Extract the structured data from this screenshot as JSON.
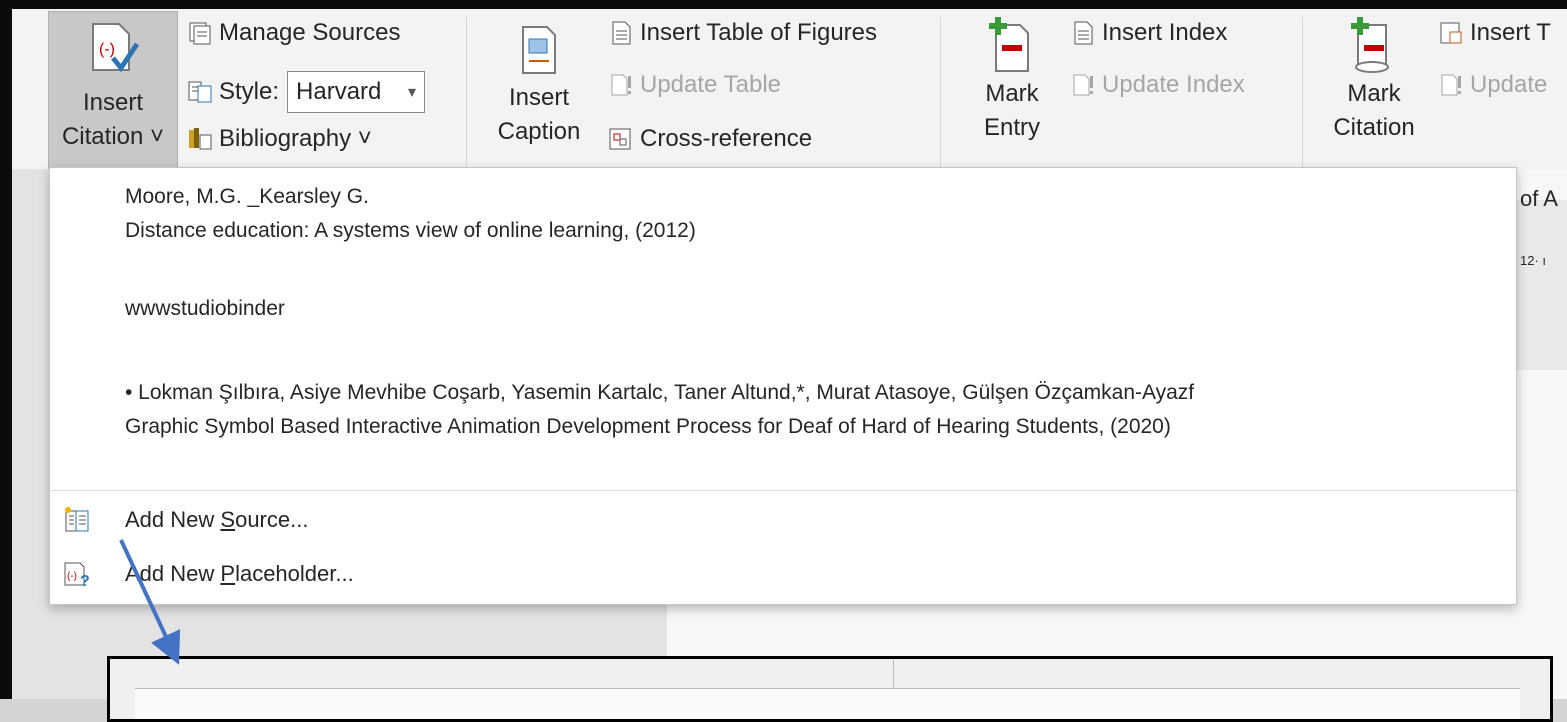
{
  "ribbon": {
    "insert_citation": {
      "line1": "Insert",
      "line2": "Citation ˅"
    },
    "manage_sources": "Manage Sources",
    "style_label": "Style:",
    "style_value": "Harvard",
    "bibliography": "Bibliography ˅",
    "insert_caption": {
      "line1": "Insert",
      "line2": "Caption"
    },
    "insert_table_of_figures": "Insert Table of Figures",
    "update_table": "Update Table",
    "cross_reference": "Cross-reference",
    "mark_entry": {
      "line1": "Mark",
      "line2": "Entry"
    },
    "insert_index": "Insert Index",
    "update_index": "Update Index",
    "mark_citation": {
      "line1": "Mark",
      "line2": "Citation"
    },
    "insert_t_partial": "Insert T",
    "update_partial": "Update"
  },
  "document": {
    "partial_text": "of A",
    "ruler_partial": "12· ı"
  },
  "citation_menu": {
    "sources": [
      {
        "author": "Moore, M.G. _Kearsley G.",
        "title": "Distance education: A systems view of online learning, (2012)"
      },
      {
        "author": "wwwstudiobinder",
        "title": ""
      },
      {
        "author": "• Lokman Şılbıra, Asiye Mevhibe Coşarb, Yasemin Kartalc, Taner Altund,*, Murat Atasoye, Gülşen Özçamkan-Ayazf",
        "title": "Graphic Symbol Based Interactive Animation Development Process for Deaf of Hard of Hearing Students, (2020)"
      }
    ],
    "add_new_source": {
      "pre": "Add New ",
      "accel": "S",
      "post": "ource..."
    },
    "add_new_placeholder": {
      "pre": "Add New ",
      "accel": "P",
      "post": "laceholder..."
    }
  },
  "colors": {
    "accent_blue": "#4472c4",
    "arrow": "#4472c4"
  }
}
